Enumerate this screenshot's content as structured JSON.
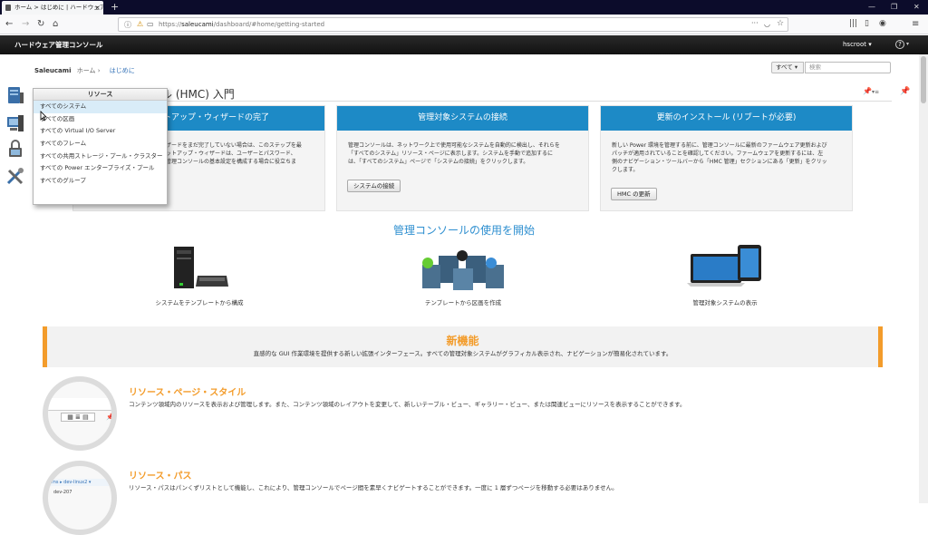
{
  "browser": {
    "tab_title": "ホーム > はじめに | ハードウェア管理コン",
    "url_prefix": "https://",
    "url_host": "saleucami",
    "url_path": "/dashboard/#home/getting-started"
  },
  "app": {
    "title": "ハードウェア管理コンソール",
    "user": "hscroot",
    "help_label": "?"
  },
  "breadcrumb": {
    "system": "Saleucami",
    "home": "ホーム",
    "current": "はじめに"
  },
  "search": {
    "scope": "すべて",
    "placeholder": "検索"
  },
  "page_title": "ル (HMC) 入門",
  "cards": [
    {
      "title": "ットアップ・ウィザードの完了",
      "body": "ザードをまだ完了していない場合は、このステップを最\nットアップ・ウィザードは、ユーザーとパスワード、\n管理コンソールの基本設定を構成する場合に役立ちま"
    },
    {
      "title": "管理対象システムの接続",
      "body": "管理コンソールは、ネットワーク上で使用可能なシステムを自動的に検出し、それらを\n「すべてのシステム」リソース・ページに表示します。システムを手動で追加するに\nは、「すべてのシステム」ページで「システムの接続」をクリックします。",
      "button": "システムの接続"
    },
    {
      "title": "更新のインストール (リブートが必要)",
      "body": "新しい Power 環境を管理する前に、管理コンソールに最新のファームウェア更新および\nパッチが適用されていることを確認してください。ファームウェアを更新するには、左\n側のナビゲーション・ツールバーから「HMC 管理」セクションにある「更新」をクリッ\nクします。",
      "button": "HMC の更新"
    }
  ],
  "usage_heading": "管理コンソールの使用を開始",
  "features": [
    "システムをテンプレートから構成",
    "テンプレートから区画を作成",
    "管理対象システムの表示"
  ],
  "whats_new": {
    "title": "新機能",
    "description": "直感的な GUI 作業環境を提供する新しい拡張インターフェース。すべての管理対象システムがグラフィカル表示され、ナビゲーションが簡易化されています。"
  },
  "sections": [
    {
      "title": "リソース・ページ・スタイル",
      "description": "コンテンツ領域内のリソースを表示および管理します。また、コンテンツ領域のレイアウトを変更して、新しいテーブル・ビュー、ギャラリー・ビュー、または関連ビューにリソースを表示することができます。"
    },
    {
      "title": "リソース・パス",
      "description": "リソース・パスはパンくずリストとして機能し、これにより、管理コンソールでページ間を素早くナビゲートすることができます。一度に 1 層ずつページを移動する必要はありません。",
      "thumb_label_1": "dev-linux2",
      "thumb_label_2": "dev-207"
    }
  ],
  "resource_menu": {
    "title": "リソース",
    "items": [
      "すべてのシステム",
      "すべての区画",
      "すべての Virtual I/O Server",
      "すべてのフレーム",
      "すべての共用ストレージ・プール・クラスター",
      "すべての Power エンタープライズ・プール",
      "すべてのグループ"
    ],
    "highlighted_index": 0
  }
}
